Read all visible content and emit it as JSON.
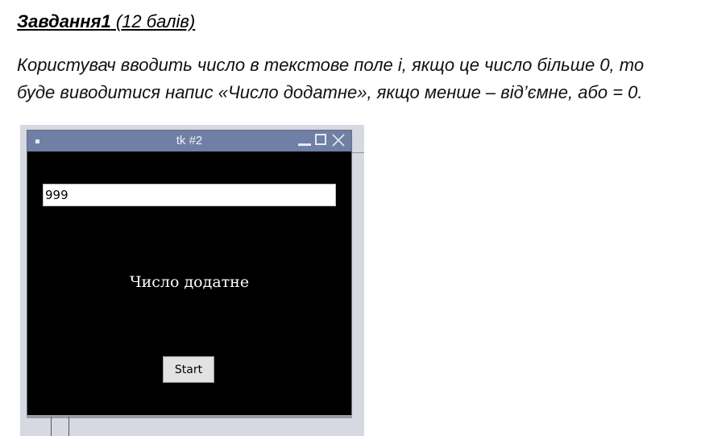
{
  "task": {
    "title_bold": "Завдання1",
    "title_rest": " (12 балів)",
    "description_line1": "Користувач вводить число в текстове поле і, якщо це число більше 0, то",
    "description_line2": "буде виводитися напис «Число додатне», якщо менше – від’ємне, або = 0."
  },
  "window": {
    "title": "tk #2",
    "controls": [
      "minimize-icon",
      "maximize-icon",
      "close-icon"
    ],
    "entry_value": "999",
    "result_label": "Число додатне",
    "start_button": "Start"
  },
  "colors": {
    "titlebar": "#6f7fa5",
    "window_bg": "#000000",
    "button_bg": "#e2e2e2"
  }
}
